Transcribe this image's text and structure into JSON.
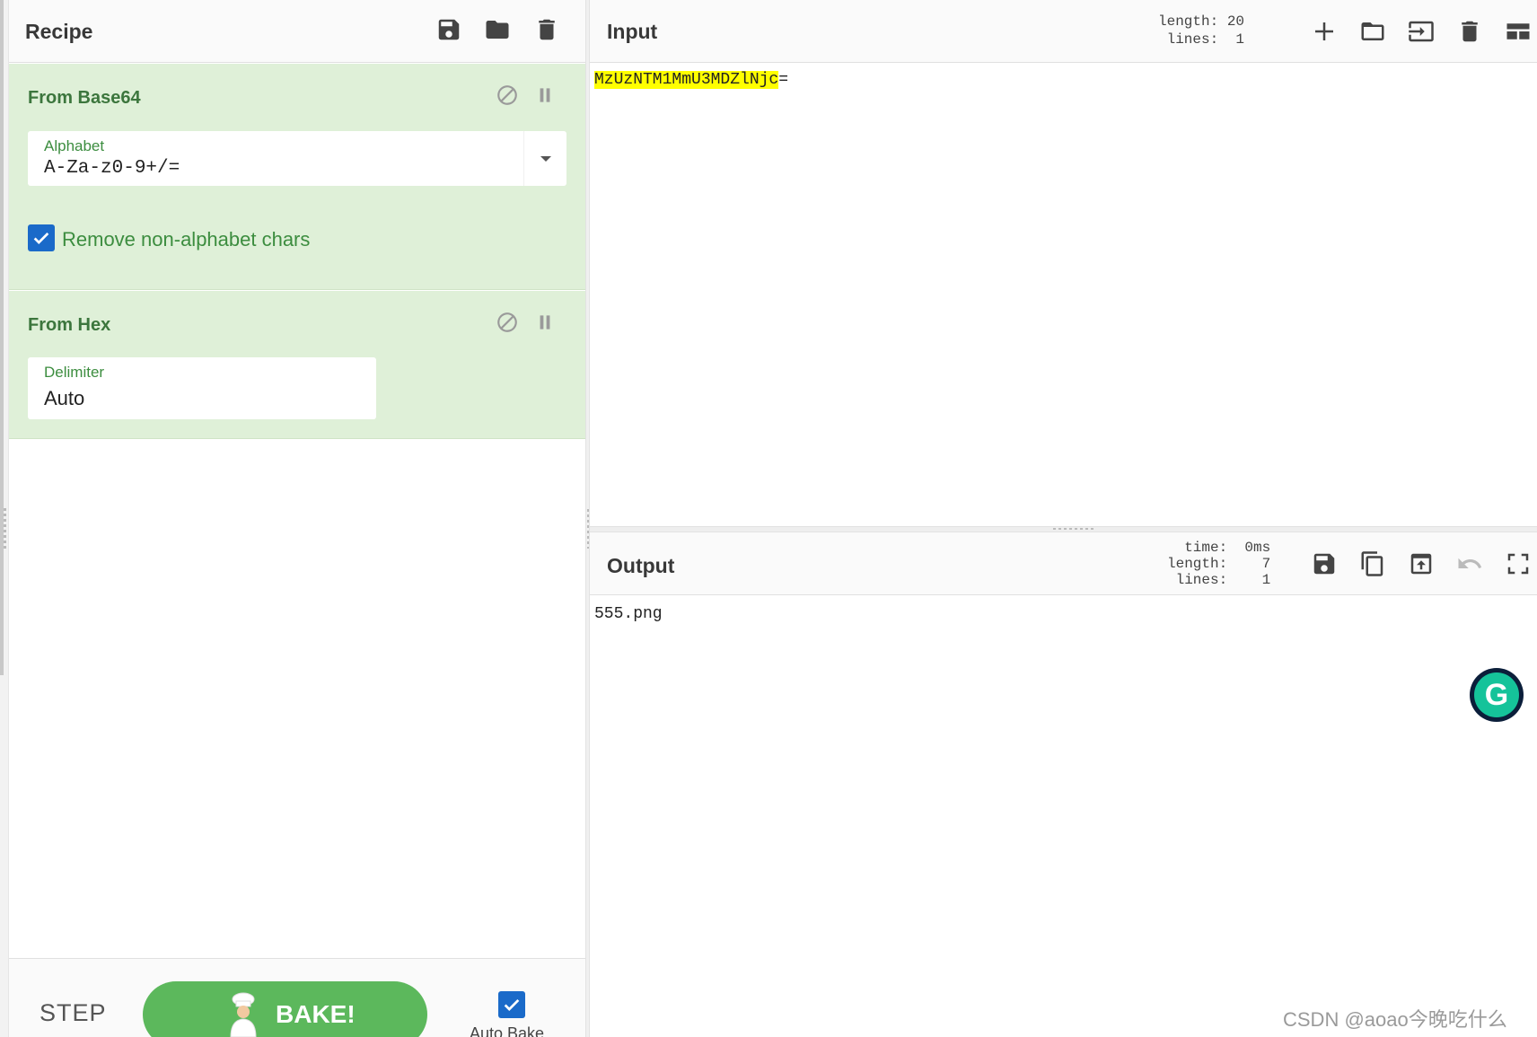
{
  "recipe": {
    "title": "Recipe",
    "header_icons": [
      "save-icon",
      "folder-icon",
      "trash-icon"
    ],
    "operations": [
      {
        "title": "From Base64",
        "controls": [
          "disable-icon",
          "pause-icon"
        ],
        "alphabet": {
          "label": "Alphabet",
          "value": "A-Za-z0-9+/="
        },
        "remove_non_alphabet": {
          "label": "Remove non-alphabet chars",
          "checked": true
        }
      },
      {
        "title": "From Hex",
        "controls": [
          "disable-icon",
          "pause-icon"
        ],
        "delimiter": {
          "label": "Delimiter",
          "value": "Auto"
        }
      }
    ],
    "footer": {
      "step_label": "STEP",
      "bake_label": "BAKE!",
      "auto_bake_label": "Auto Bake",
      "auto_bake_checked": true
    }
  },
  "input": {
    "title": "Input",
    "stats": "length: 20\n lines:  1",
    "highlighted_text": "MzUzNTM1MmU3MDZlNjc",
    "rest_text": "=",
    "header_icons": [
      "plus-icon",
      "folder-icon",
      "input-file-icon",
      "trash-icon",
      "layout-icon"
    ]
  },
  "output": {
    "title": "Output",
    "stats": "  time:  0ms\nlength:    7\n lines:    1",
    "text": "555.png",
    "header_icons": [
      "save-icon",
      "copy-icon",
      "replace-input-icon",
      "undo-icon",
      "fullscreen-icon"
    ]
  },
  "overlay": {
    "grammarly_glyph": "G",
    "watermark": "CSDN @aoao今晚吃什么"
  },
  "colors": {
    "operation_bg": "#dff0d8",
    "operation_title": "#3c763d",
    "bake_button": "#5cb85c",
    "checkbox": "#1a6ac9",
    "highlight": "#ffff00"
  }
}
